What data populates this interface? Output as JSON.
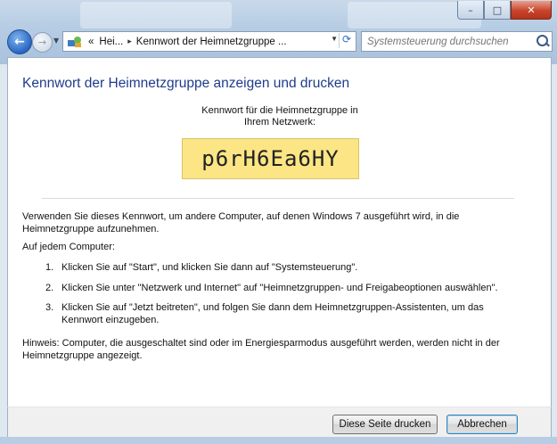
{
  "window": {
    "caption": {
      "minimize": "–",
      "maximize": "□",
      "close": "✕"
    }
  },
  "nav": {
    "breadcrumb": [
      "«",
      "Hei...",
      "▸",
      "Kennwort der Heimnetzgruppe ..."
    ],
    "search_placeholder": "Systemsteuerung durchsuchen"
  },
  "page": {
    "title": "Kennwort der Heimnetzgruppe anzeigen und drucken",
    "pw_label_line1": "Kennwort für die Heimnetzgruppe in",
    "pw_label_line2": "Ihrem Netzwerk:",
    "password": "p6rH6Ea6HY",
    "intro_line1": "Verwenden Sie dieses Kennwort, um andere Computer, auf denen Windows 7 ausgeführt wird, in die",
    "intro_line2": "Heimnetzgruppe aufzunehmen.",
    "on_each": "Auf jedem Computer:",
    "steps": [
      {
        "num": "1.",
        "line1": "Klicken Sie auf \"Start\", und klicken Sie dann auf \"Systemsteuerung\".",
        "line2": ""
      },
      {
        "num": "2.",
        "line1": "Klicken Sie unter \"Netzwerk und Internet\" auf \"Heimnetzgruppen- und Freigabeoptionen auswählen\".",
        "line2": ""
      },
      {
        "num": "3.",
        "line1": "Klicken Sie auf \"Jetzt beitreten\", und folgen Sie dann dem Heimnetzgruppen-Assistenten, um das",
        "line2": "Kennwort einzugeben."
      }
    ],
    "note_line1": "Hinweis: Computer, die ausgeschaltet sind oder im Energiesparmodus ausgeführt werden, werden nicht in der",
    "note_line2": "Heimnetzgruppe angezeigt."
  },
  "buttons": {
    "print": "Diese Seite drucken",
    "cancel": "Abbrechen"
  },
  "colors": {
    "title_blue": "#1e3c8c",
    "password_box": "#fbe584"
  }
}
